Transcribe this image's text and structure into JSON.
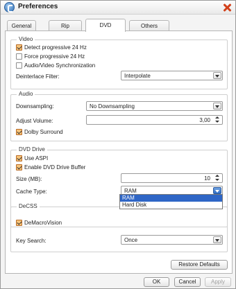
{
  "window": {
    "title": "Preferences"
  },
  "tabs": [
    {
      "label": "General"
    },
    {
      "label": "Rip"
    },
    {
      "label": "DVD"
    },
    {
      "label": "Others"
    }
  ],
  "video": {
    "title": "Video",
    "detect_progressive": {
      "label": "Detect progressive 24 Hz",
      "checked": true
    },
    "force_progressive": {
      "label": "Force progressive 24 Hz",
      "checked": false
    },
    "av_sync": {
      "label": "Audio/Video Synchronization",
      "checked": false
    },
    "deinterlace_label": "Deinterlace Filter:",
    "deinterlace_value": "Interpolate"
  },
  "audio": {
    "title": "Audio",
    "downsampling_label": "Downsampling:",
    "downsampling_value": "No Downsampling",
    "volume_label": "Adjust Volume:",
    "volume_value": "3,00",
    "dolby": {
      "label": "Dolby Surround",
      "checked": true
    }
  },
  "dvd_drive": {
    "title": "DVD Drive",
    "use_aspi": {
      "label": "Use ASPI",
      "checked": true
    },
    "drive_buffer": {
      "label": "Enable DVD Drive Buffer",
      "checked": true
    },
    "size_label": "Size (MB):",
    "size_value": "10",
    "cache_label": "Cache Type:",
    "cache_value": "RAM",
    "cache_options": [
      "RAM",
      "Hard Disk"
    ]
  },
  "decss": {
    "title": "DeCSS",
    "demacrovision": {
      "label": "DeMacroVision",
      "checked": true
    },
    "key_search_label": "Key Search:",
    "key_search_value": "Once"
  },
  "buttons": {
    "restore_defaults": "Restore Defaults",
    "ok": "OK",
    "cancel": "Cancel",
    "apply": "Apply"
  }
}
